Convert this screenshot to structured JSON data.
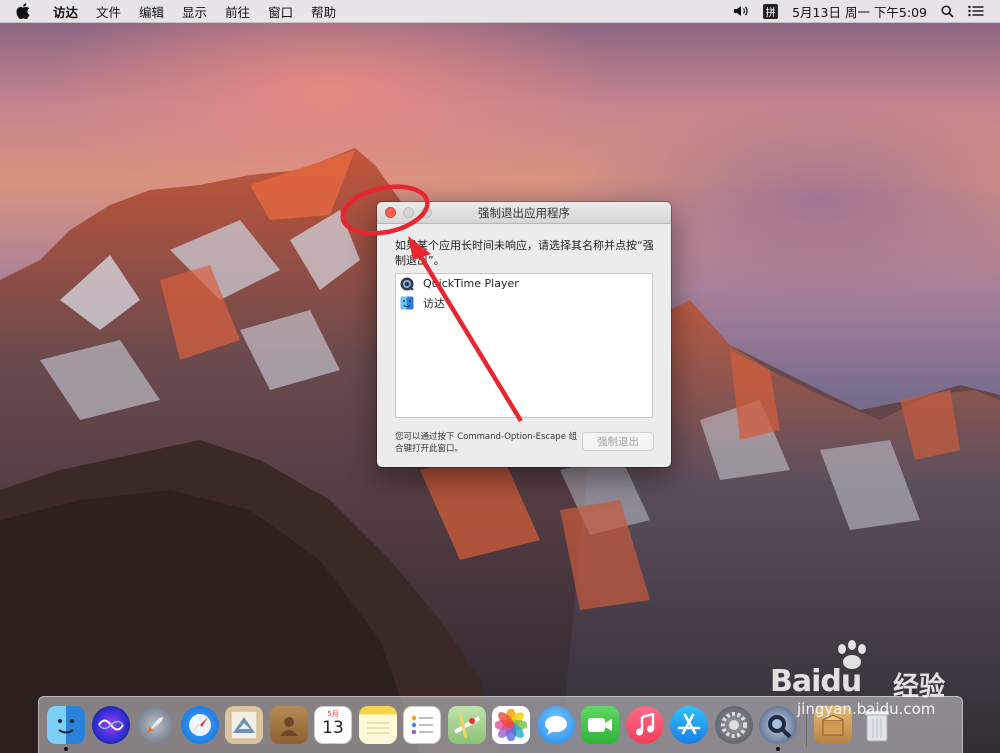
{
  "menubar": {
    "app_name": "访达",
    "menus": [
      "文件",
      "编辑",
      "显示",
      "前往",
      "窗口",
      "帮助"
    ],
    "input_method": "拼",
    "datetime": "5月13日 周一 下午5:09"
  },
  "force_quit": {
    "title": "强制退出应用程序",
    "prompt": "如果某个应用长时间未响应，请选择其名称并点按“强制退出”。",
    "apps": [
      {
        "name": "QuickTime Player",
        "icon": "quicktime-icon"
      },
      {
        "name": "访达",
        "icon": "finder-icon"
      }
    ],
    "hint": "您可以通过按下 Command-Option-Escape 组合键打开此窗口。",
    "button_label": "强制退出"
  },
  "dock": {
    "calendar_month": "5月",
    "calendar_day": "13"
  },
  "watermark": {
    "brand": "Baidu",
    "brand_cn": "经验",
    "url": "jingyan.baidu.com"
  },
  "colors": {
    "close_light": "#fc5f57",
    "annotation": "#e8262f",
    "disabled_button_text": "#a4a4a4"
  }
}
